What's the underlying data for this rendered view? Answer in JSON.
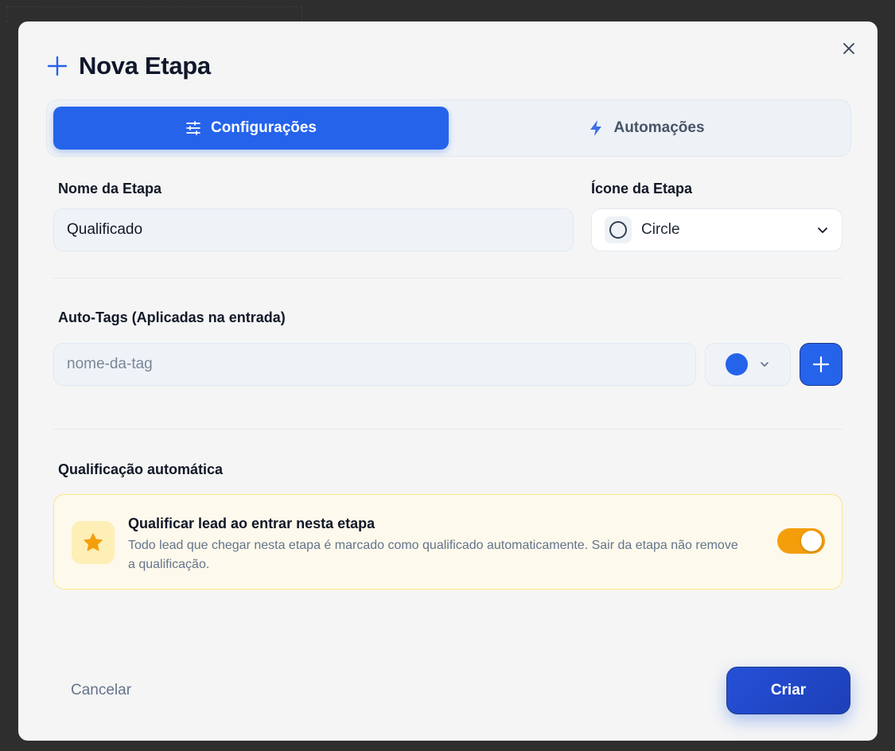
{
  "modal": {
    "title": "Nova Etapa"
  },
  "tabs": [
    {
      "label": "Configurações",
      "icon": "sliders-icon",
      "active": true
    },
    {
      "label": "Automações",
      "icon": "lightning-icon",
      "active": false
    }
  ],
  "stage_name": {
    "label": "Nome da Etapa",
    "value": "Qualificado"
  },
  "stage_icon": {
    "label": "Ícone da Etapa",
    "selected": "Circle",
    "icon": "circle-icon"
  },
  "auto_tags": {
    "label": "Auto-Tags (Aplicadas na entrada)",
    "placeholder": "nome-da-tag",
    "color": "#2563eb"
  },
  "auto_qualification": {
    "section_label": "Qualificação automática",
    "title": "Qualificar lead ao entrar nesta etapa",
    "description": "Todo lead que chegar nesta etapa é marcado como qualificado automaticamente. Sair da etapa não remove a qualificação.",
    "enabled": true,
    "icon": "star-icon"
  },
  "footer": {
    "cancel_label": "Cancelar",
    "create_label": "Criar"
  },
  "colors": {
    "primary": "#2563eb",
    "toggle_on": "#f59e0b",
    "card_bg": "#fdf9ec",
    "card_border": "#fde68a"
  }
}
